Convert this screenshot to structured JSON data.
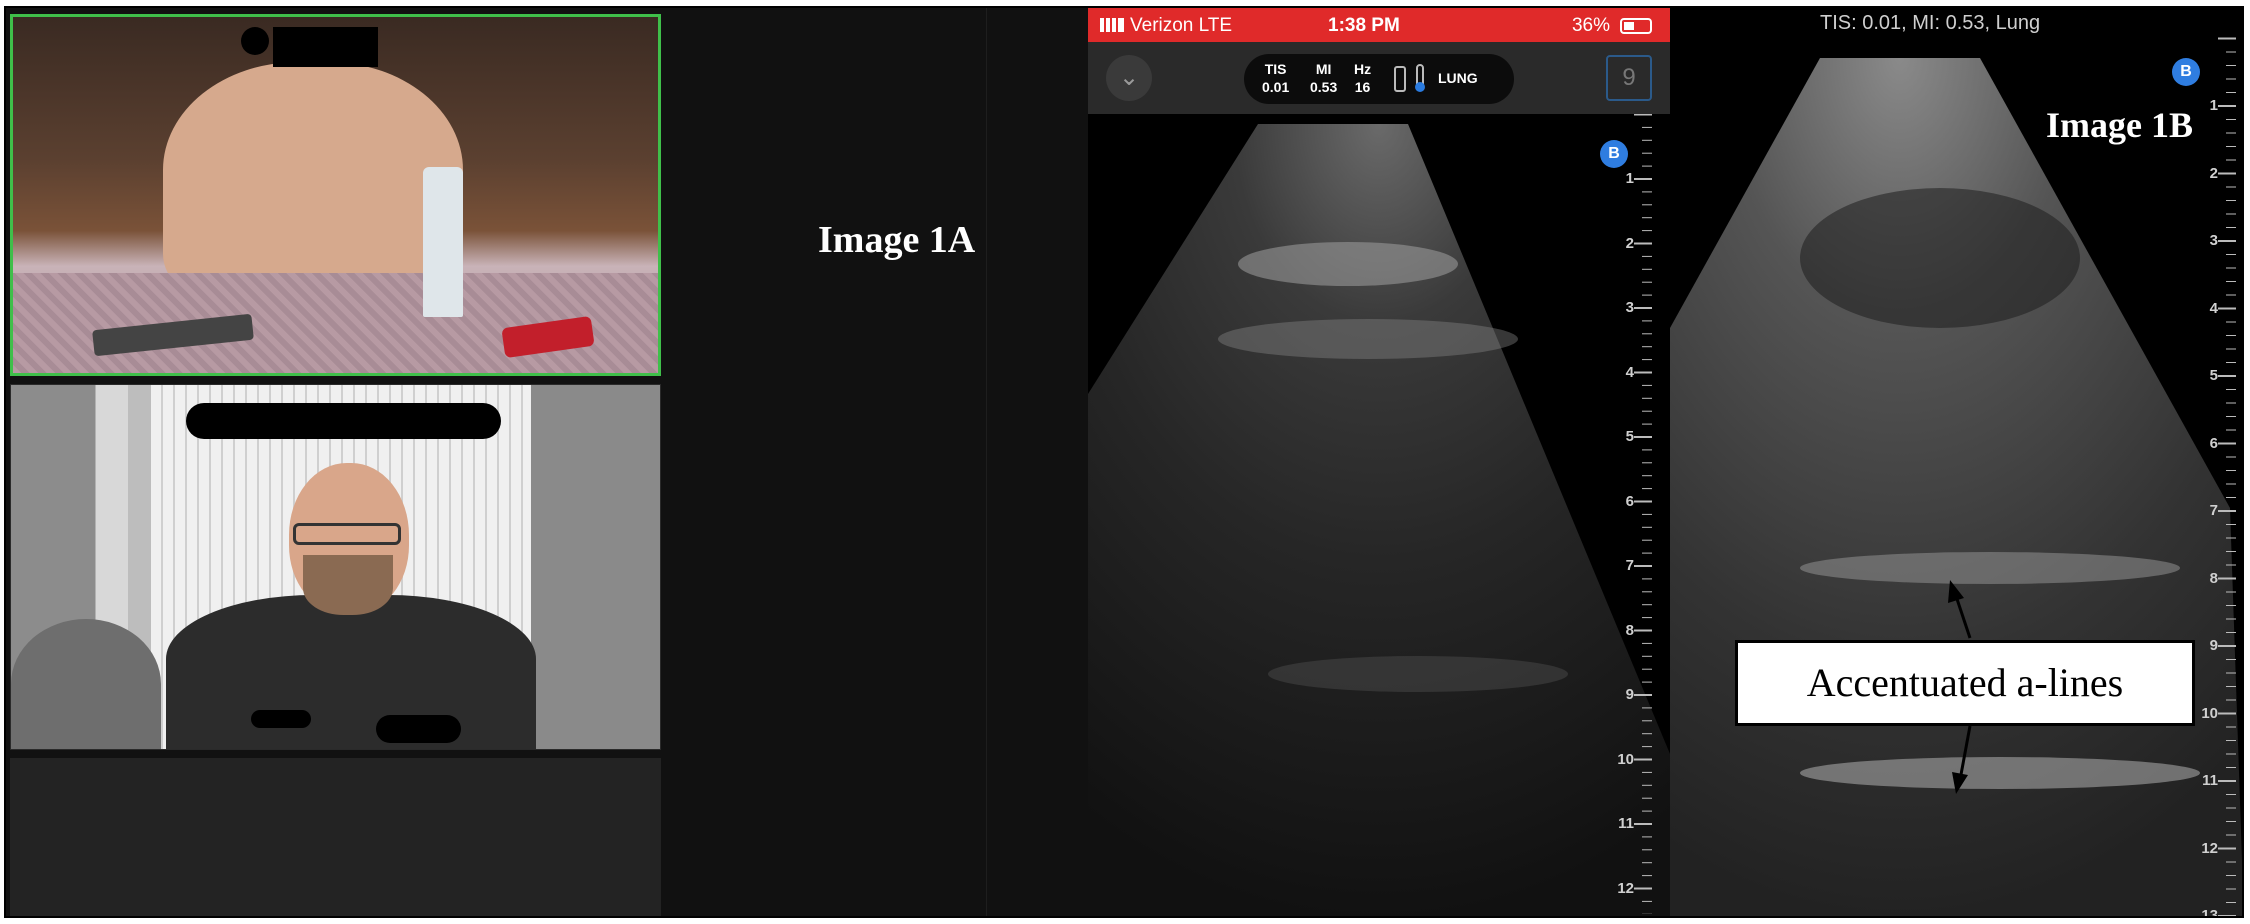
{
  "video_call": {
    "tiles": [
      {
        "name": "patient-video-tile",
        "active_speaker": true
      },
      {
        "name": "clinician-video-tile",
        "active_speaker": false
      },
      {
        "name": "empty-tile"
      }
    ],
    "active_border_color": "#3fbf4a"
  },
  "labels": {
    "image_1a": "Image 1A",
    "image_1b": "Image 1B",
    "callout": "Accentuated a-lines"
  },
  "phone": {
    "status_bar": {
      "carrier": "Verizon  LTE",
      "time": "1:38 PM",
      "battery": "36%",
      "color": "#e02a2a"
    },
    "toolbar": {
      "chevron": "⌄",
      "tis_label": "TIS",
      "tis_value": "0.01",
      "mi_label": "MI",
      "mi_value": "0.53",
      "hz_label": "Hz",
      "hz_value": "16",
      "preset": "LUNG",
      "depth_button": "9"
    },
    "badge": "B",
    "depth_ticks": [
      "1",
      "2",
      "3",
      "4",
      "5",
      "6",
      "7",
      "8",
      "9",
      "10",
      "11",
      "12"
    ]
  },
  "panel_1b": {
    "header": "TIS: 0.01, MI: 0.53, Lung",
    "badge": "B",
    "depth_ticks": [
      "1",
      "2",
      "3",
      "4",
      "5",
      "6",
      "7",
      "8",
      "9",
      "10",
      "11",
      "12",
      "13"
    ]
  }
}
